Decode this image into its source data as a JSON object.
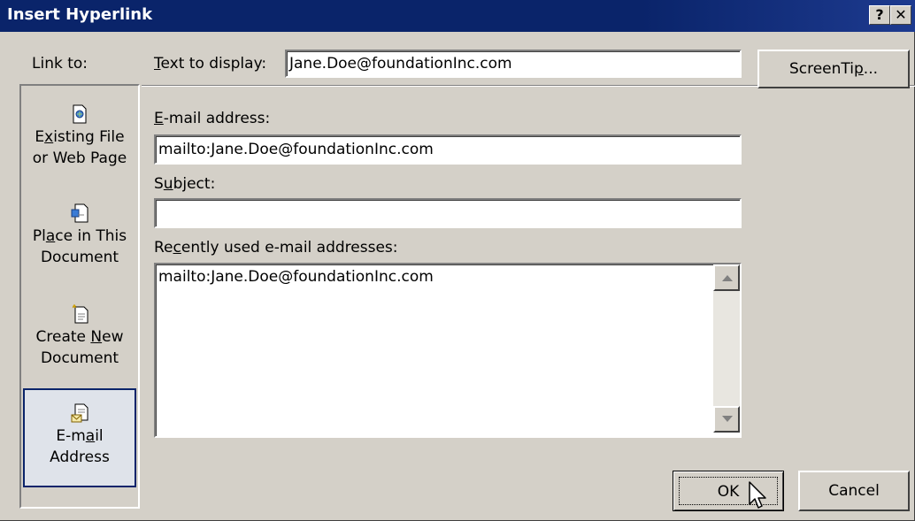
{
  "window": {
    "title": "Insert Hyperlink",
    "help_label": "?",
    "close_label": "✕"
  },
  "sidebar": {
    "heading": "Link to:",
    "items": [
      {
        "line1_pre": "E",
        "line1_u": "x",
        "line1_post": "isting File",
        "line2": "or Web Page",
        "icon": "existing-file-icon",
        "selected": false
      },
      {
        "line1_pre": "Pl",
        "line1_u": "a",
        "line1_post": "ce in This",
        "line2": "Document",
        "icon": "place-in-document-icon",
        "selected": false
      },
      {
        "line1_pre": "Create ",
        "line1_u": "N",
        "line1_post": "ew",
        "line2": "Document",
        "icon": "create-new-document-icon",
        "selected": false
      },
      {
        "line1_pre": "E-m",
        "line1_u": "a",
        "line1_post": "il",
        "line2": "Address",
        "icon": "email-address-icon",
        "selected": true
      }
    ]
  },
  "text_to_display": {
    "label_u": "T",
    "label_rest": "ext to display:",
    "value": "Jane.Doe@foundationInc.com"
  },
  "screentip": {
    "label_pre": "ScreenTi",
    "label_u": "p",
    "label_post": "..."
  },
  "email_address": {
    "label_u": "E",
    "label_rest": "-mail address:",
    "value": "mailto:Jane.Doe@foundationInc.com"
  },
  "subject": {
    "label_pre": "S",
    "label_u": "u",
    "label_post": "bject:",
    "value": ""
  },
  "recent": {
    "label_pre": "Re",
    "label_u": "c",
    "label_post": "ently used e-mail addresses:",
    "items": [
      "mailto:Jane.Doe@foundationInc.com"
    ]
  },
  "buttons": {
    "ok": "OK",
    "cancel": "Cancel"
  },
  "colors": {
    "titlebar": "#0a246a",
    "face": "#d4d0c8",
    "selected_item": "#dfe3ea"
  }
}
